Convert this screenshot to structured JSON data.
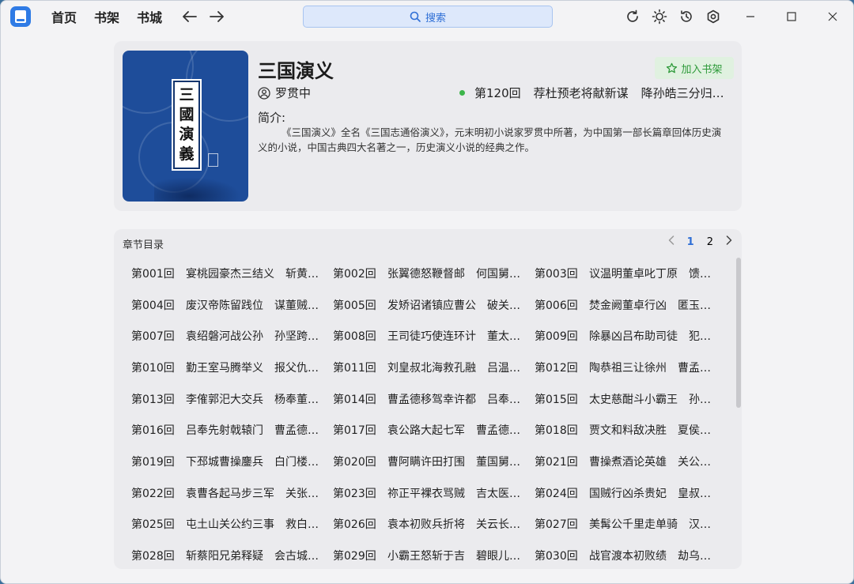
{
  "nav": {
    "home": "首页",
    "bookshelf": "书架",
    "bookstore": "书城"
  },
  "search": {
    "placeholder": "搜索"
  },
  "book": {
    "title": "三国演义",
    "author": "罗贯中",
    "add_shelf": "加入书架",
    "latest_chapter_num": "第120回",
    "latest_chapter_name": "荐杜预老将献新谋",
    "latest_chapter_extra": "降孙皓三分归一统",
    "intro_label": "简介:",
    "intro_text": "《三国演义》全名《三国志通俗演义》，元末明初小说家罗贯中所著，为中国第一部长篇章回体历史演义的小说，中国古典四大名著之一，历史演义小说的经典之作。",
    "cover_chars": [
      "三",
      "國",
      "演",
      "義"
    ]
  },
  "chapters": {
    "header": "章节目录",
    "pages": [
      "1",
      "2"
    ],
    "active_page": "1",
    "items": [
      {
        "num": "第001回",
        "t1": "宴桃园豪杰三结义",
        "t2": "斩黄巾英雄首立功"
      },
      {
        "num": "第002回",
        "t1": "张翼德怒鞭督邮",
        "t2": "何国舅谋诛宦竖"
      },
      {
        "num": "第003回",
        "t1": "议温明董卓叱丁原",
        "t2": "馈金珠李肃说吕布"
      },
      {
        "num": "第004回",
        "t1": "废汉帝陈留践位",
        "t2": "谋董贼孟德献刀"
      },
      {
        "num": "第005回",
        "t1": "发矫诏诸镇应曹公",
        "t2": "破关兵三英战吕布"
      },
      {
        "num": "第006回",
        "t1": "焚金阙董卓行凶",
        "t2": "匿玉玺孙坚背约"
      },
      {
        "num": "第007回",
        "t1": "袁绍磐河战公孙",
        "t2": "孙坚跨江击刘表"
      },
      {
        "num": "第008回",
        "t1": "王司徒巧使连环计",
        "t2": "董太师大闹凤仪亭"
      },
      {
        "num": "第009回",
        "t1": "除暴凶吕布助司徒",
        "t2": "犯长安李傕听贾诩"
      },
      {
        "num": "第010回",
        "t1": "勤王室马腾举义",
        "t2": "报父仇曹操兴师"
      },
      {
        "num": "第011回",
        "t1": "刘皇叔北海救孔融",
        "t2": "吕温侯濮阳破曹操"
      },
      {
        "num": "第012回",
        "t1": "陶恭祖三让徐州",
        "t2": "曹孟德大战吕布"
      },
      {
        "num": "第013回",
        "t1": "李傕郭汜大交兵",
        "t2": "杨奉董承双救驾"
      },
      {
        "num": "第014回",
        "t1": "曹孟德移驾幸许都",
        "t2": "吕奉先乘夜袭徐郡"
      },
      {
        "num": "第015回",
        "t1": "太史慈酣斗小霸王",
        "t2": "孙伯符大战严白虎"
      },
      {
        "num": "第016回",
        "t1": "吕奉先射戟辕门",
        "t2": "曹孟德败师淯水"
      },
      {
        "num": "第017回",
        "t1": "袁公路大起七军",
        "t2": "曹孟德会合三将"
      },
      {
        "num": "第018回",
        "t1": "贾文和料敌决胜",
        "t2": "夏侯惇拔矢啖睛"
      },
      {
        "num": "第019回",
        "t1": "下邳城曹操鏖兵",
        "t2": "白门楼吕布殒命"
      },
      {
        "num": "第020回",
        "t1": "曹阿瞒许田打围",
        "t2": "董国舅内阁受诏"
      },
      {
        "num": "第021回",
        "t1": "曹操煮酒论英雄",
        "t2": "关公赚城斩车胄"
      },
      {
        "num": "第022回",
        "t1": "袁曹各起马步三军",
        "t2": "关张共擒王刘二将"
      },
      {
        "num": "第023回",
        "t1": "祢正平裸衣骂贼",
        "t2": "吉太医下毒遭刑"
      },
      {
        "num": "第024回",
        "t1": "国贼行凶杀贵妃",
        "t2": "皇叔败走投袁绍"
      },
      {
        "num": "第025回",
        "t1": "屯土山关公约三事",
        "t2": "救白马曹操解重围"
      },
      {
        "num": "第026回",
        "t1": "袁本初败兵折将",
        "t2": "关云长挂印封金"
      },
      {
        "num": "第027回",
        "t1": "美髯公千里走单骑",
        "t2": "汉寿侯五关斩六将"
      },
      {
        "num": "第028回",
        "t1": "斩蔡阳兄弟释疑",
        "t2": "会古城主臣聚义"
      },
      {
        "num": "第029回",
        "t1": "小霸王怒斩于吉",
        "t2": "碧眼儿坐领江东"
      },
      {
        "num": "第030回",
        "t1": "战官渡本初败绩",
        "t2": "劫乌巢孟德烧粮"
      }
    ]
  }
}
